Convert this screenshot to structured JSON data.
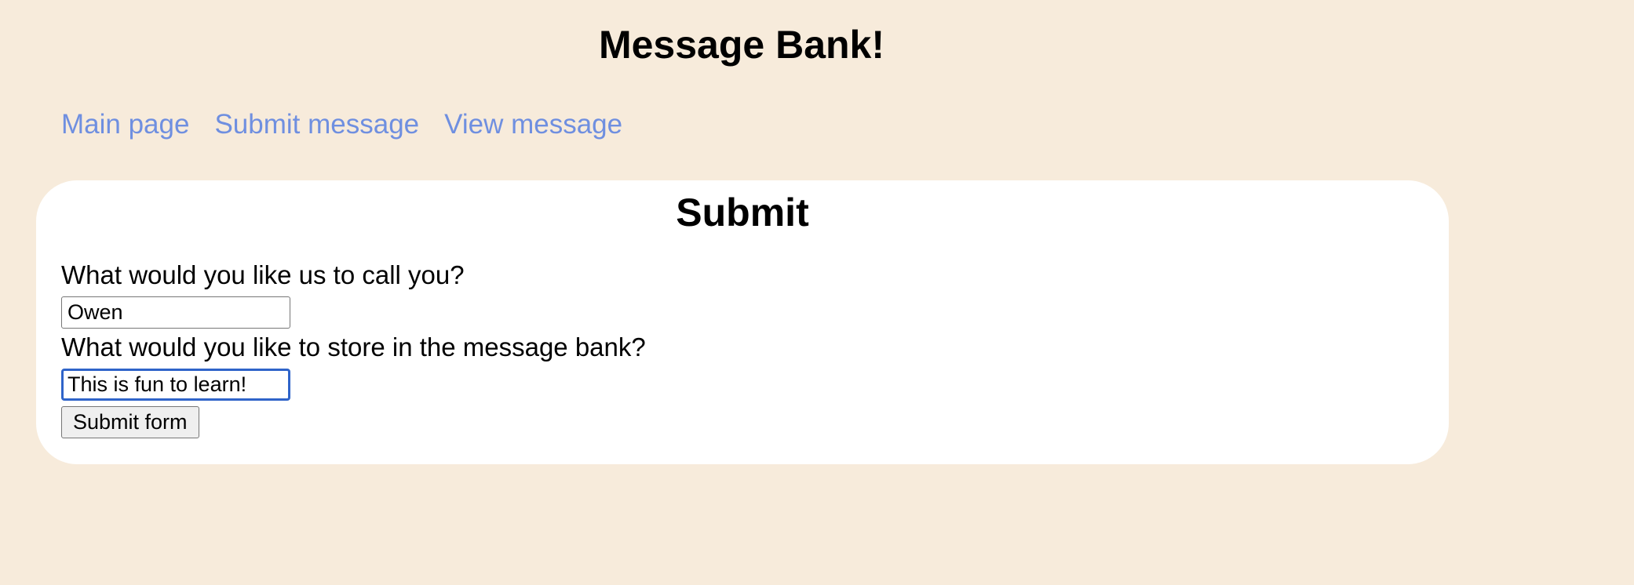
{
  "header": {
    "title": "Message Bank!"
  },
  "nav": {
    "items": [
      {
        "label": "Main page"
      },
      {
        "label": "Submit message"
      },
      {
        "label": "View message"
      }
    ]
  },
  "form": {
    "title": "Submit",
    "name_label": "What would you like us to call you?",
    "name_value": "Owen",
    "message_label": "What would you like to store in the message bank?",
    "message_value": "This is fun to learn!",
    "submit_label": "Submit form"
  },
  "colors": {
    "background": "#f7ebdb",
    "link": "#6f8fe0",
    "focus_border": "#2f64c9",
    "card": "#ffffff"
  }
}
